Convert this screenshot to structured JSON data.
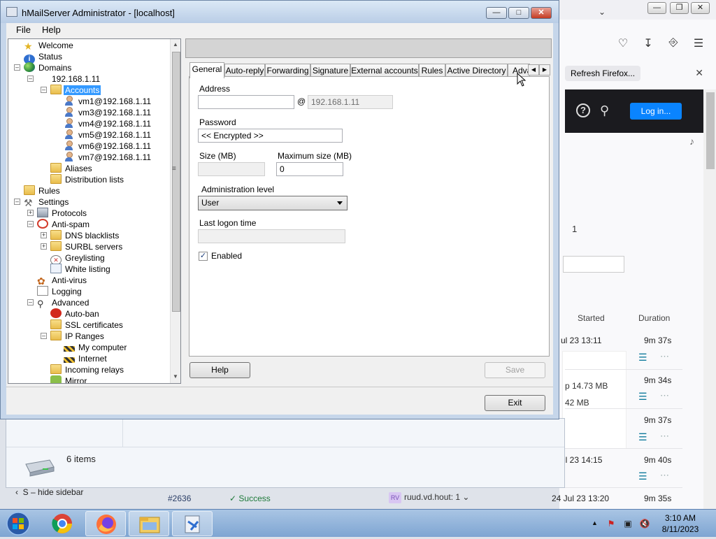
{
  "window": {
    "title": "hMailServer Administrator - [localhost]",
    "menu": [
      "File",
      "Help"
    ]
  },
  "tree": {
    "nodes": [
      {
        "label": "Welcome",
        "icon": "star-icon"
      },
      {
        "label": "Status",
        "icon": "info-icon"
      },
      {
        "label": "Domains",
        "icon": "globe-icon"
      },
      {
        "label": "192.168.1.11",
        "icon": "none"
      },
      {
        "label": "Accounts",
        "icon": "folder-open-icon"
      },
      {
        "label": "vm1@192.168.1.11",
        "icon": "user-icon"
      },
      {
        "label": "vm3@192.168.1.11",
        "icon": "user-icon"
      },
      {
        "label": "vm4@192.168.1.11",
        "icon": "user-icon"
      },
      {
        "label": "vm5@192.168.1.11",
        "icon": "user-icon"
      },
      {
        "label": "vm6@192.168.1.11",
        "icon": "user-icon"
      },
      {
        "label": "vm7@192.168.1.11",
        "icon": "user-icon"
      },
      {
        "label": "Aliases",
        "icon": "folder-icon"
      },
      {
        "label": "Distribution lists",
        "icon": "folder-icon"
      },
      {
        "label": "Rules",
        "icon": "folder-icon"
      },
      {
        "label": "Settings",
        "icon": "tools-icon"
      },
      {
        "label": "Protocols",
        "icon": "server-icon"
      },
      {
        "label": "Anti-spam",
        "icon": "no-entry-icon"
      },
      {
        "label": "DNS blacklists",
        "icon": "folder-icon"
      },
      {
        "label": "SURBL servers",
        "icon": "folder-icon"
      },
      {
        "label": "Greylisting",
        "icon": "clock-icon"
      },
      {
        "label": "White listing",
        "icon": "list-icon"
      },
      {
        "label": "Anti-virus",
        "icon": "bug-icon"
      },
      {
        "label": "Logging",
        "icon": "document-icon"
      },
      {
        "label": "Advanced",
        "icon": "magnifier-icon"
      },
      {
        "label": "Auto-ban",
        "icon": "stop-icon"
      },
      {
        "label": "SSL certificates",
        "icon": "folder-icon"
      },
      {
        "label": "IP Ranges",
        "icon": "folder-icon"
      },
      {
        "label": "My computer",
        "icon": "barrier-icon"
      },
      {
        "label": "Internet",
        "icon": "barrier-icon"
      },
      {
        "label": "Incoming relays",
        "icon": "folder-icon"
      },
      {
        "label": "Mirror",
        "icon": "mirror-icon"
      }
    ]
  },
  "tabs": [
    "General",
    "Auto-reply",
    "Forwarding",
    "Signature",
    "External accounts",
    "Rules",
    "Active Directory",
    "Adva"
  ],
  "form": {
    "address_label": "Address",
    "address_value": "",
    "at_sign": "@",
    "domain_value": "192.168.1.11",
    "password_label": "Password",
    "password_value": "<< Encrypted >>",
    "size_label": "Size (MB)",
    "size_value": "",
    "max_size_label": "Maximum size (MB)",
    "max_size_value": "0",
    "admin_level_label": "Administration level",
    "admin_level_value": "User",
    "last_logon_label": "Last logon time",
    "last_logon_value": "",
    "enabled_label": "Enabled",
    "enabled_checked": true
  },
  "buttons": {
    "help": "Help",
    "save": "Save",
    "exit": "Exit"
  },
  "background": {
    "firefox_notification": "Refresh Firefox...",
    "login_button": "Log in...",
    "page_number": "1",
    "col_started": "Started",
    "col_duration": "Duration",
    "rows": [
      {
        "started": "ul 23 13:11",
        "duration": "9m 37s"
      },
      {
        "started": "",
        "duration": "9m 34s"
      },
      {
        "started": "",
        "duration": "9m 37s"
      },
      {
        "started": "ul 23 14:15",
        "duration": "9m 40s"
      }
    ],
    "card_size_1": "p  14.73 MB",
    "card_size_2": "42 MB",
    "explorer_items": "6 items",
    "hide_sidebar": "S – hide sidebar",
    "pr_number": "#2636",
    "pr_status": "Success",
    "pr_avatar": "RV",
    "pr_user": "ruud.vd.hout: 1",
    "pr_date": "24 Jul 23 13:20",
    "pr_duration": "9m 35s"
  },
  "taskbar": {
    "time": "3:10 AM",
    "date": "8/11/2023"
  }
}
